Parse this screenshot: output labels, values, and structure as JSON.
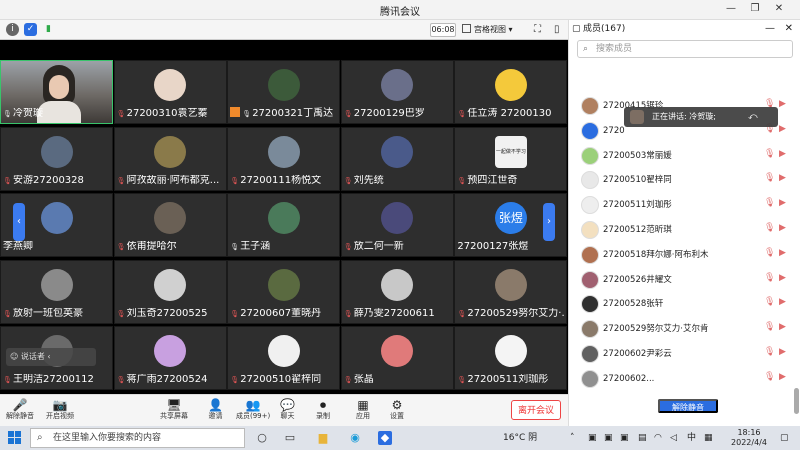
{
  "window": {
    "title": "腾讯会议"
  },
  "topbar": {
    "timer": "06:08",
    "view_mode": "宫格视图"
  },
  "tiles": [
    {
      "name": "冷贺璇",
      "mic": "on",
      "avatar": "camera",
      "color": "#7a7067"
    },
    {
      "name": "27200310袁艺蓁",
      "mic": "muted",
      "avatar": "photo",
      "color": "#e8d6c8"
    },
    {
      "name": "27200321丁禹达",
      "mic": "on",
      "avatar": "photo",
      "color": "#3c5a3a",
      "badge": "orange"
    },
    {
      "name": "27200129巴罗",
      "mic": "muted",
      "avatar": "photo",
      "color": "#6a6f8a"
    },
    {
      "name": "任立涛 27200130",
      "mic": "muted",
      "avatar": "emoji",
      "color": "#f4c93b"
    },
    {
      "name": "安游27200328",
      "mic": "muted",
      "avatar": "photo",
      "color": "#5a6a80"
    },
    {
      "name": "阿孜故丽·阿布都克...",
      "mic": "muted",
      "avatar": "photo",
      "color": "#8a7a4a"
    },
    {
      "name": "27200111杨悦文",
      "mic": "muted",
      "avatar": "photo",
      "color": "#7a8a9a"
    },
    {
      "name": "刘先统",
      "mic": "muted",
      "avatar": "photo",
      "color": "#4a5a8a"
    },
    {
      "name": "预四江世奇",
      "mic": "muted",
      "avatar": "sign",
      "color": "#f1f1f1",
      "avatar_text": "一起做不学习"
    },
    {
      "name": "李燕卿",
      "mic": "none",
      "avatar": "photo",
      "color": "#5a7ab0"
    },
    {
      "name": "依甫提哈尔",
      "mic": "muted",
      "avatar": "photo",
      "color": "#6a6055"
    },
    {
      "name": "王子涵",
      "mic": "on",
      "avatar": "photo",
      "color": "#4a7a5a"
    },
    {
      "name": "放二何一新",
      "mic": "muted",
      "avatar": "photo",
      "color": "#4a4a7a"
    },
    {
      "name": "27200127张煜",
      "mic": "none",
      "avatar": "text",
      "color": "#2b7de9",
      "avatar_text": "张煜"
    },
    {
      "name": "放射一班包英豪",
      "mic": "muted",
      "avatar": "photo",
      "color": "#8a8a8a"
    },
    {
      "name": "刘玉奇27200525",
      "mic": "muted",
      "avatar": "blank",
      "color": "#d0d0d0"
    },
    {
      "name": "27200607董晓丹",
      "mic": "muted",
      "avatar": "photo",
      "color": "#5a6a40"
    },
    {
      "name": "薛乃雯27200611",
      "mic": "muted",
      "avatar": "photo",
      "color": "#c8c8c8"
    },
    {
      "name": "27200529努尔艾力·...",
      "mic": "muted",
      "avatar": "photo",
      "color": "#8a7a6a"
    },
    {
      "name": "王明洁27200112",
      "mic": "muted",
      "avatar": "photo",
      "color": "#6a6a6a"
    },
    {
      "name": "蒋广雨27200524",
      "mic": "muted",
      "avatar": "photo",
      "color": "#c8a0e0"
    },
    {
      "name": "27200510翟梓同",
      "mic": "muted",
      "avatar": "photo",
      "color": "#f0f0f0"
    },
    {
      "name": "张晶",
      "mic": "muted",
      "avatar": "photo",
      "color": "#e07a7a"
    },
    {
      "name": "27200511刘珈彤",
      "mic": "muted",
      "avatar": "photo",
      "color": "#f4f4f4"
    }
  ],
  "overlay_tools": "说话者",
  "toolbar": {
    "items": [
      {
        "label": "解除静音",
        "icon": "🎤"
      },
      {
        "label": "开启视频",
        "icon": "📷"
      },
      {
        "label": "共享屏幕",
        "icon": "🖥"
      },
      {
        "label": "邀请",
        "icon": "👤"
      },
      {
        "label": "成员(99+)",
        "icon": "👥"
      },
      {
        "label": "聊天",
        "icon": "💬"
      },
      {
        "label": "录制",
        "icon": "⏺"
      },
      {
        "label": "应用",
        "icon": "▦"
      },
      {
        "label": "设置",
        "icon": "⚙"
      }
    ],
    "leave": "离开会议"
  },
  "panel": {
    "title": "成员(167)",
    "search_placeholder": "搜索成员",
    "speaking": "正在讲话: 冷贺璇;",
    "unmute_all": "解除静音",
    "members": [
      {
        "name": "27200415锯珍",
        "color": "#b08060"
      },
      {
        "name": "2720",
        "color": "#2b6de0"
      },
      {
        "name": "27200503常丽媛",
        "color": "#9bd07a"
      },
      {
        "name": "27200510翟梓同",
        "color": "#e8e8e8"
      },
      {
        "name": "27200511刘珈彤",
        "color": "#eeeeee"
      },
      {
        "name": "27200512范昕琪",
        "color": "#f3e0c0"
      },
      {
        "name": "27200518拜尔娜·阿布利木",
        "color": "#b07050"
      },
      {
        "name": "27200526井耀文",
        "color": "#a06070"
      },
      {
        "name": "27200528张轩",
        "color": "#303030"
      },
      {
        "name": "27200529努尔艾力·艾尔肯",
        "color": "#8a7a6a"
      },
      {
        "name": "27200602尹彩云",
        "color": "#606060"
      },
      {
        "name": "27200602...",
        "color": "#909090"
      }
    ]
  },
  "taskbar": {
    "search_placeholder": "在这里输入你要搜索的内容",
    "weather": "16°C 阴",
    "ime": "中",
    "time": "18:16",
    "date": "2022/4/4"
  }
}
